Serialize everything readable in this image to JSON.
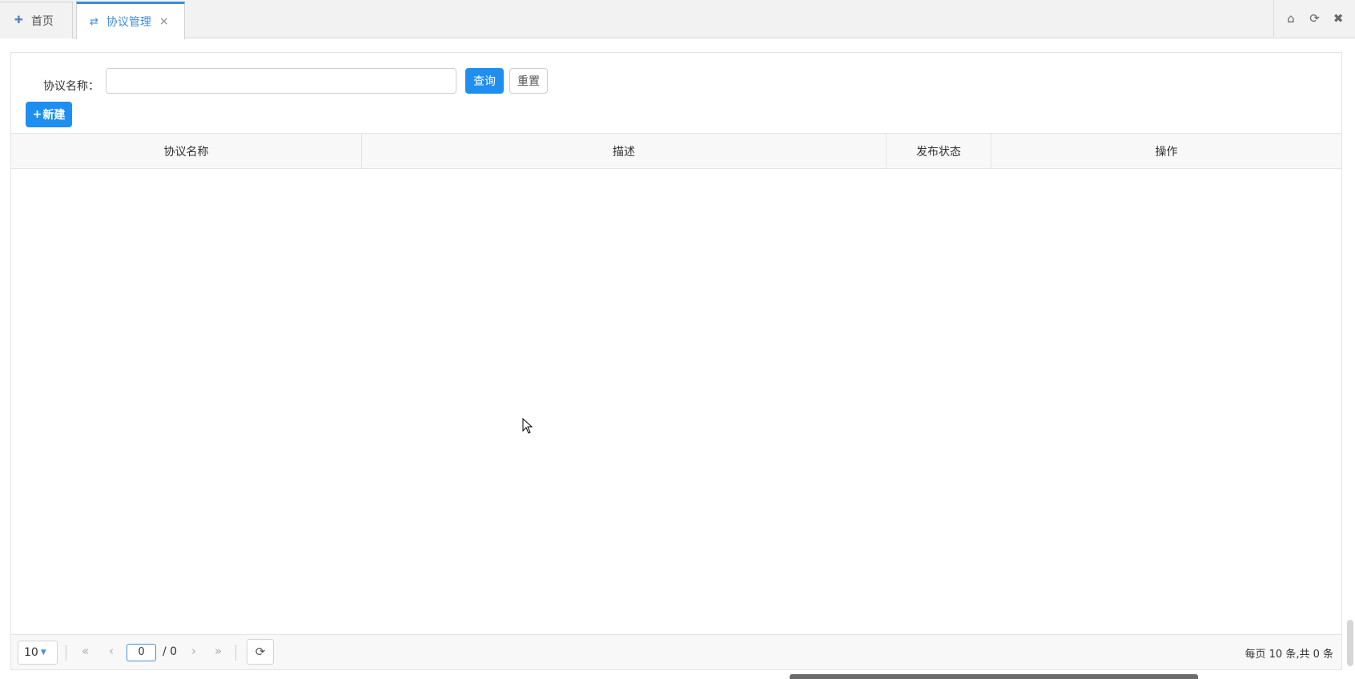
{
  "tabs": {
    "home": {
      "label": "首页",
      "icon": "puzzle-icon"
    },
    "active": {
      "label": "协议管理",
      "icon": "exchange-icon",
      "close": "×"
    },
    "tools": [
      "home-icon",
      "refresh-icon",
      "close-icon"
    ]
  },
  "search": {
    "label": "协议名称：",
    "value": "",
    "query_label": "查询",
    "reset_label": "重置"
  },
  "toolbar": {
    "new_plus": "+",
    "new_label": "新建"
  },
  "table": {
    "columns": [
      "协议名称",
      "描述",
      "发布状态",
      "操作"
    ],
    "rows": []
  },
  "pager": {
    "page_size": "10",
    "current_page": "0",
    "total_pages": "/ 0",
    "info": "每页 10 条,共 0 条"
  },
  "colors": {
    "primary": "#1e8ff0",
    "active_tab": "#3c8dd6"
  }
}
